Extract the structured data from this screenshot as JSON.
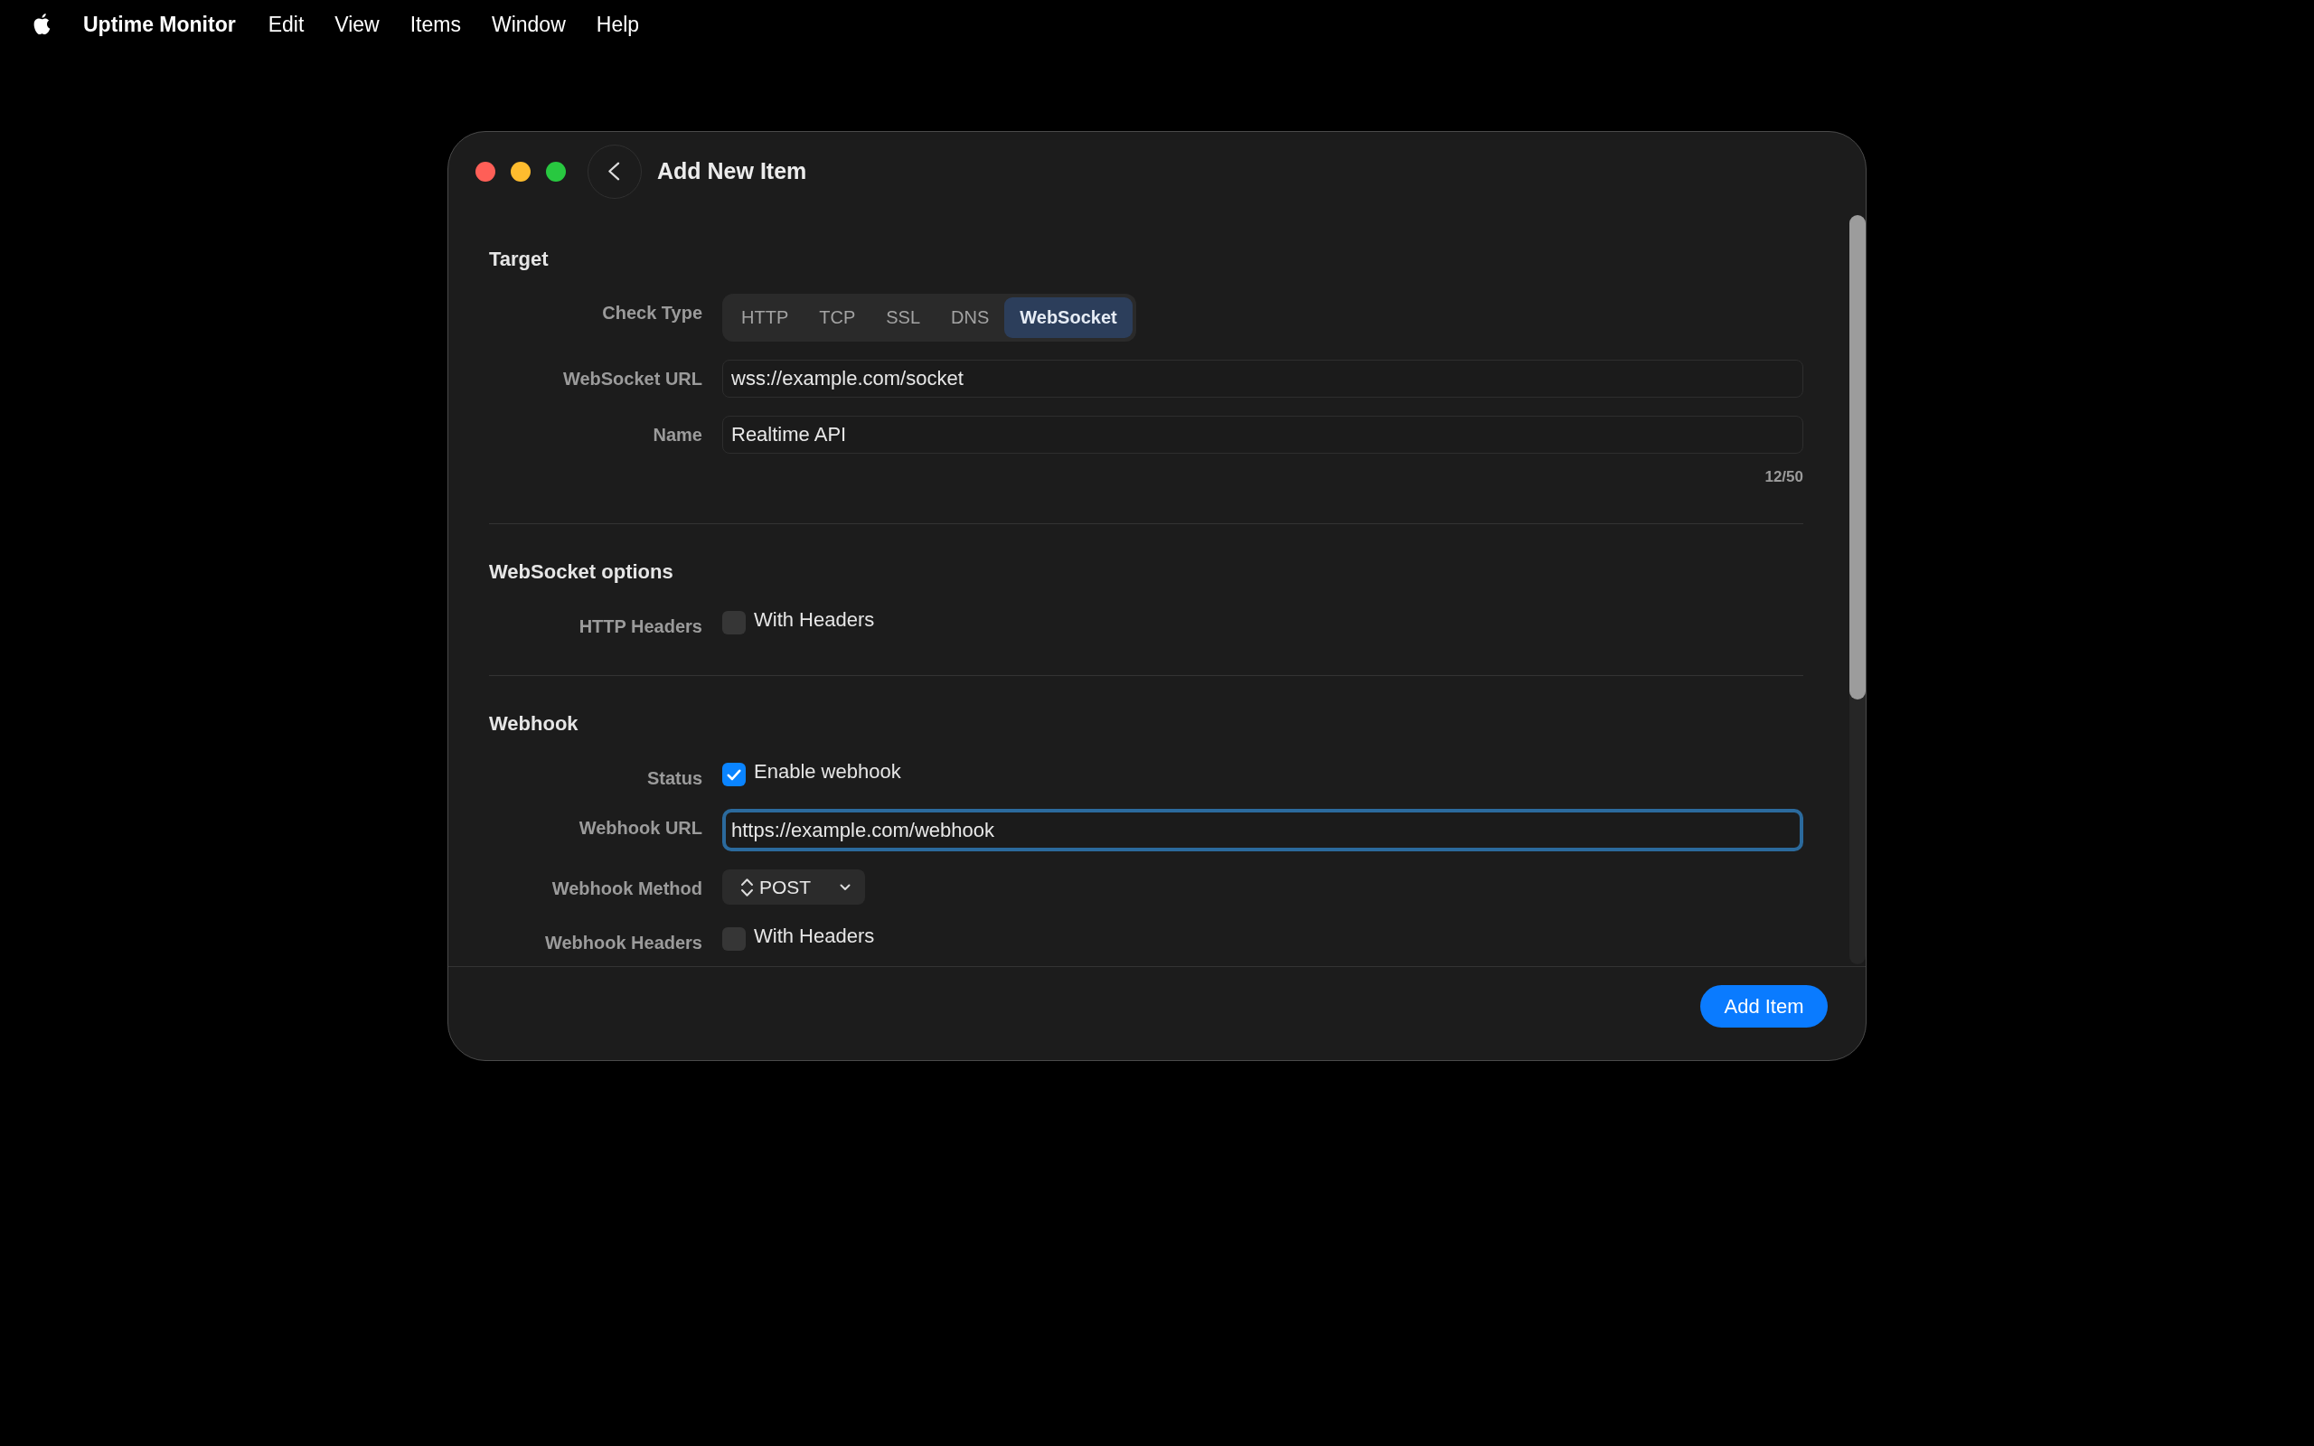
{
  "menu_bar": {
    "app_name": "Uptime Monitor",
    "items": [
      "Edit",
      "View",
      "Items",
      "Window",
      "Help"
    ]
  },
  "window": {
    "title": "Add New Item"
  },
  "sections": [
    {
      "heading": "Target",
      "rows": [
        {
          "kind": "segmented",
          "label": "Check Type",
          "options": [
            {
              "label": "HTTP",
              "selected": false
            },
            {
              "label": "TCP",
              "selected": false
            },
            {
              "label": "SSL",
              "selected": false
            },
            {
              "label": "DNS",
              "selected": false
            },
            {
              "label": "WebSocket",
              "selected": true
            }
          ]
        },
        {
          "kind": "text",
          "label": "WebSocket URL",
          "value": "wss://example.com/socket",
          "focused": false
        },
        {
          "kind": "text",
          "label": "Name",
          "value": "Realtime API",
          "focused": false,
          "counter": "12/50"
        }
      ]
    },
    {
      "heading": "WebSocket options",
      "rows": [
        {
          "kind": "checkbox",
          "label": "HTTP Headers",
          "text": "With Headers",
          "checked": false
        }
      ]
    },
    {
      "heading": "Webhook",
      "rows": [
        {
          "kind": "checkbox",
          "label": "Status",
          "text": "Enable webhook",
          "checked": true
        },
        {
          "kind": "text",
          "label": "Webhook URL",
          "value": "https://example.com/webhook",
          "focused": true
        },
        {
          "kind": "popup",
          "label": "Webhook Method",
          "value": "POST"
        },
        {
          "kind": "checkbox",
          "label": "Webhook Headers",
          "text": "With Headers",
          "checked": false
        }
      ]
    }
  ],
  "footer": {
    "primary_button": "Add Item"
  }
}
